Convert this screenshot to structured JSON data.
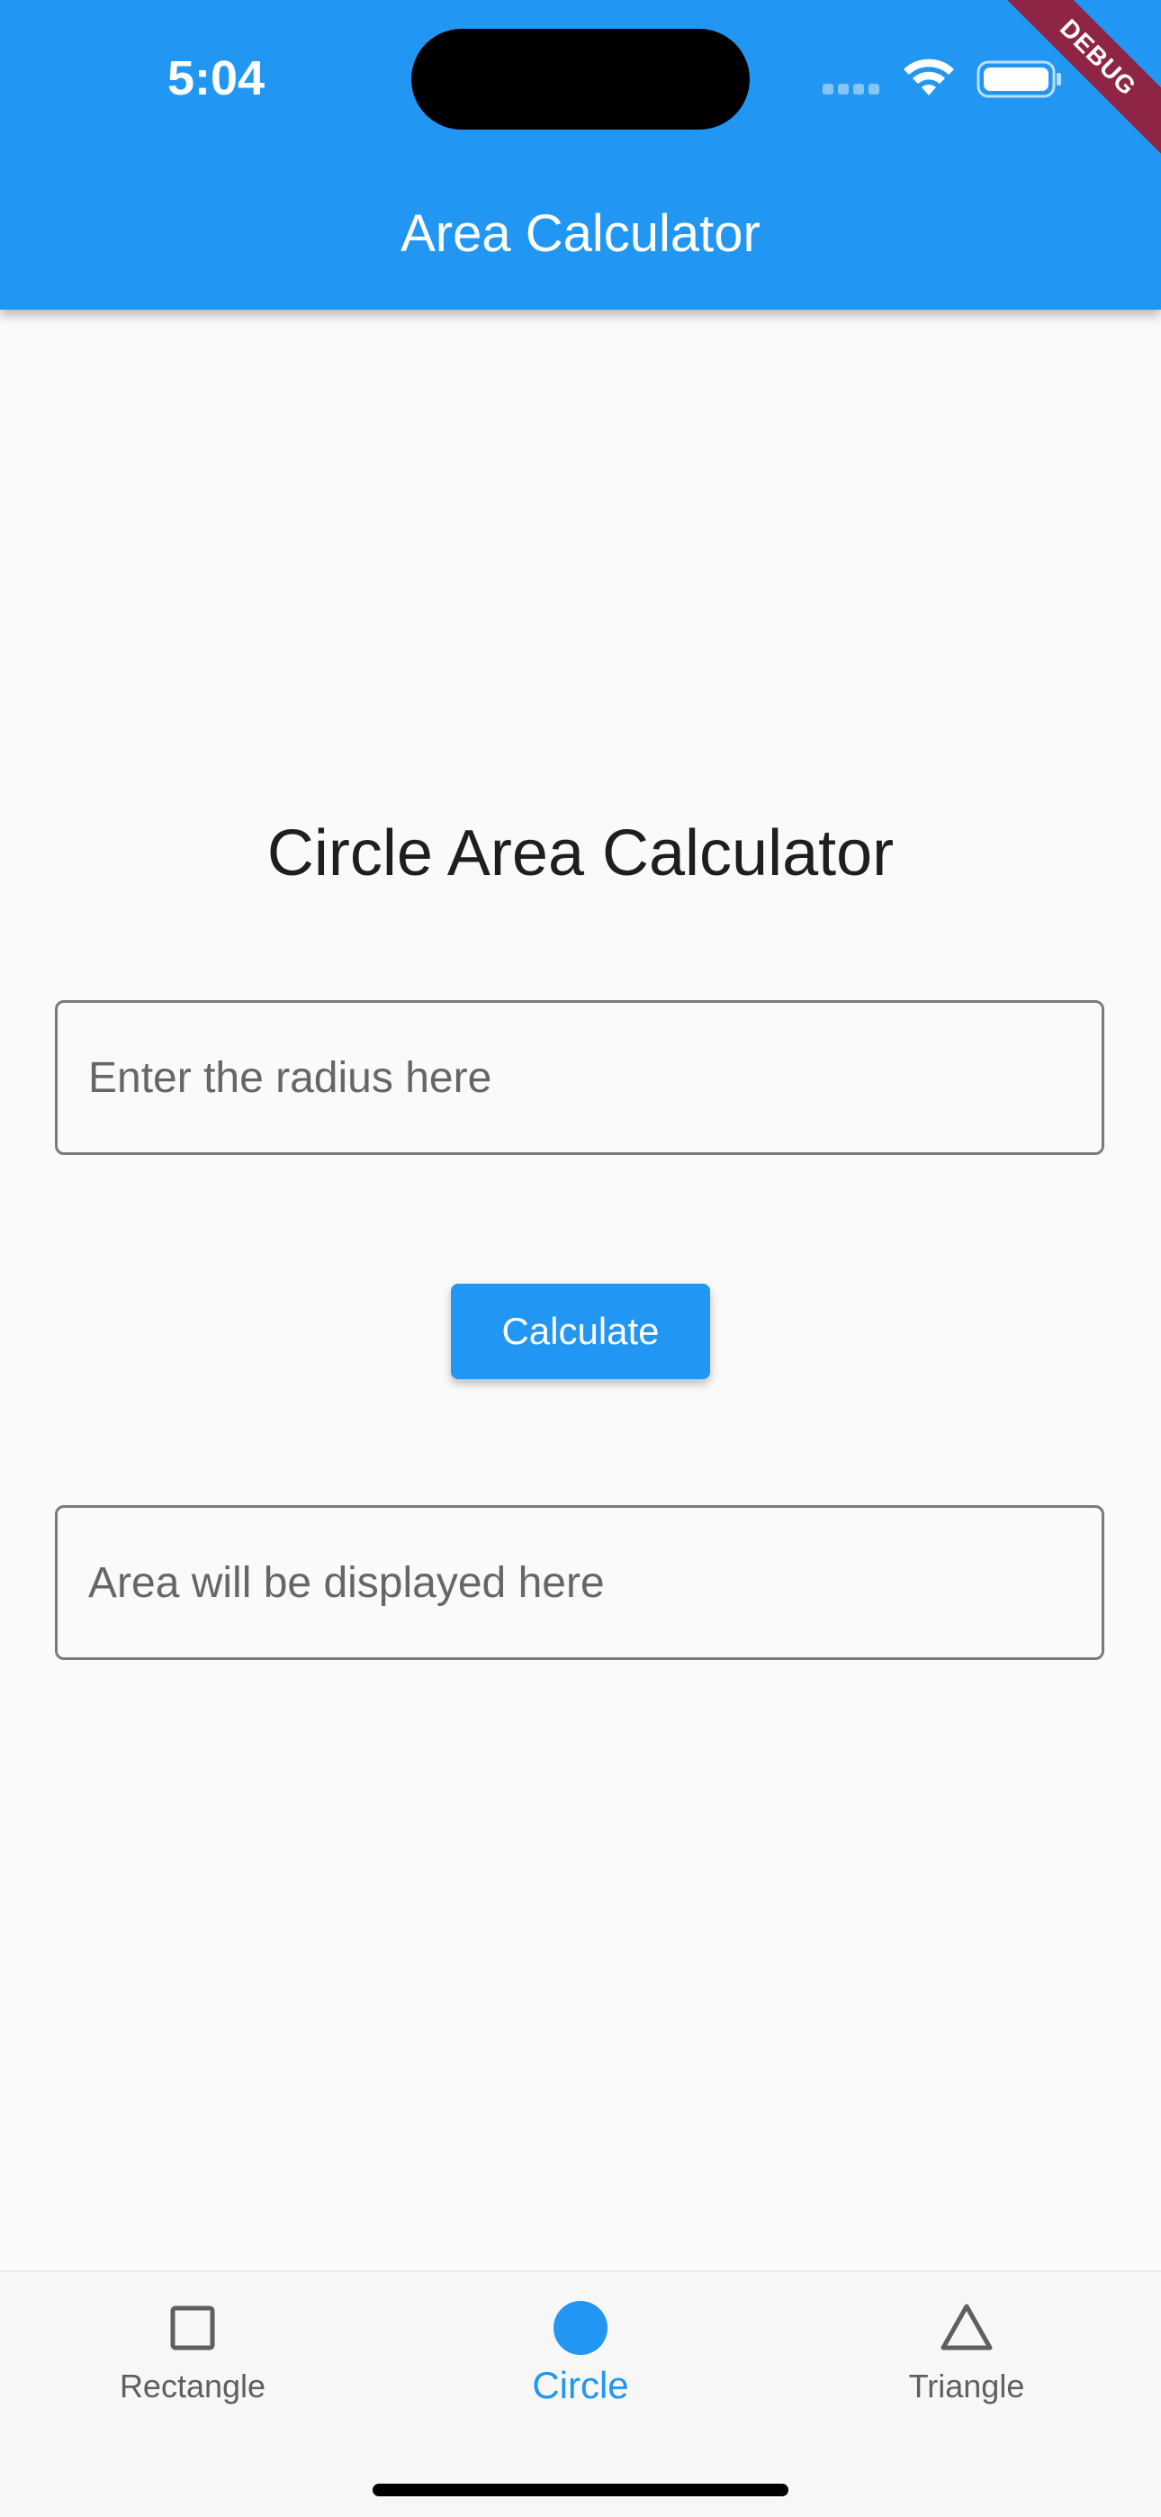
{
  "status_bar": {
    "time": "5:04",
    "signal_icon": "cellular-signal-icon",
    "wifi_icon": "wifi-icon",
    "battery_icon": "battery-icon"
  },
  "debug_banner": "DEBUG",
  "app_bar": {
    "title": "Area Calculator",
    "color": "#2196f3"
  },
  "main": {
    "heading": "Circle Area Calculator",
    "radius_input": {
      "value": "",
      "placeholder": "Enter the radius here"
    },
    "calculate_button": "Calculate",
    "area_output": {
      "value": "",
      "placeholder": "Area will be displayed here"
    }
  },
  "bottom_nav": {
    "items": [
      {
        "label": "Rectangle",
        "icon": "square-outline-icon",
        "active": false
      },
      {
        "label": "Circle",
        "icon": "filled-circle-icon",
        "active": true
      },
      {
        "label": "Triangle",
        "icon": "triangle-outline-icon",
        "active": false
      }
    ],
    "active_color": "#2196f3",
    "inactive_color": "#5f5f5f"
  }
}
